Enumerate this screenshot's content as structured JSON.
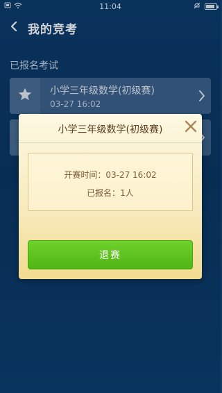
{
  "status_bar": {
    "time": "11:04",
    "left_icons": [
      "screen-icon",
      "wifi-icon"
    ],
    "right_icons": [
      "mute-icon",
      "battery-icon"
    ]
  },
  "header": {
    "title": "我的竞考",
    "back_icon": "chevron-left-icon"
  },
  "section": {
    "label": "已报名考试"
  },
  "exams": [
    {
      "title": "小学三年级数学(初级赛)",
      "time": "03-27 16:02",
      "icon": "star-icon"
    },
    {
      "title": "",
      "time": "",
      "icon": ""
    }
  ],
  "dialog": {
    "title": "小学三年级数学(初级赛)",
    "start_time_line": "开赛时间：03-27 16:02",
    "registered_line": "已报名：1人",
    "quit_button_label": "退赛",
    "close_icon": "close-icon"
  },
  "colors": {
    "background": "#0c3b6a",
    "dialog_bg": "#f7eabb",
    "button_green": "#5cc31c",
    "title_brown": "#5a3c1c",
    "close_icon": "#a8875a"
  }
}
